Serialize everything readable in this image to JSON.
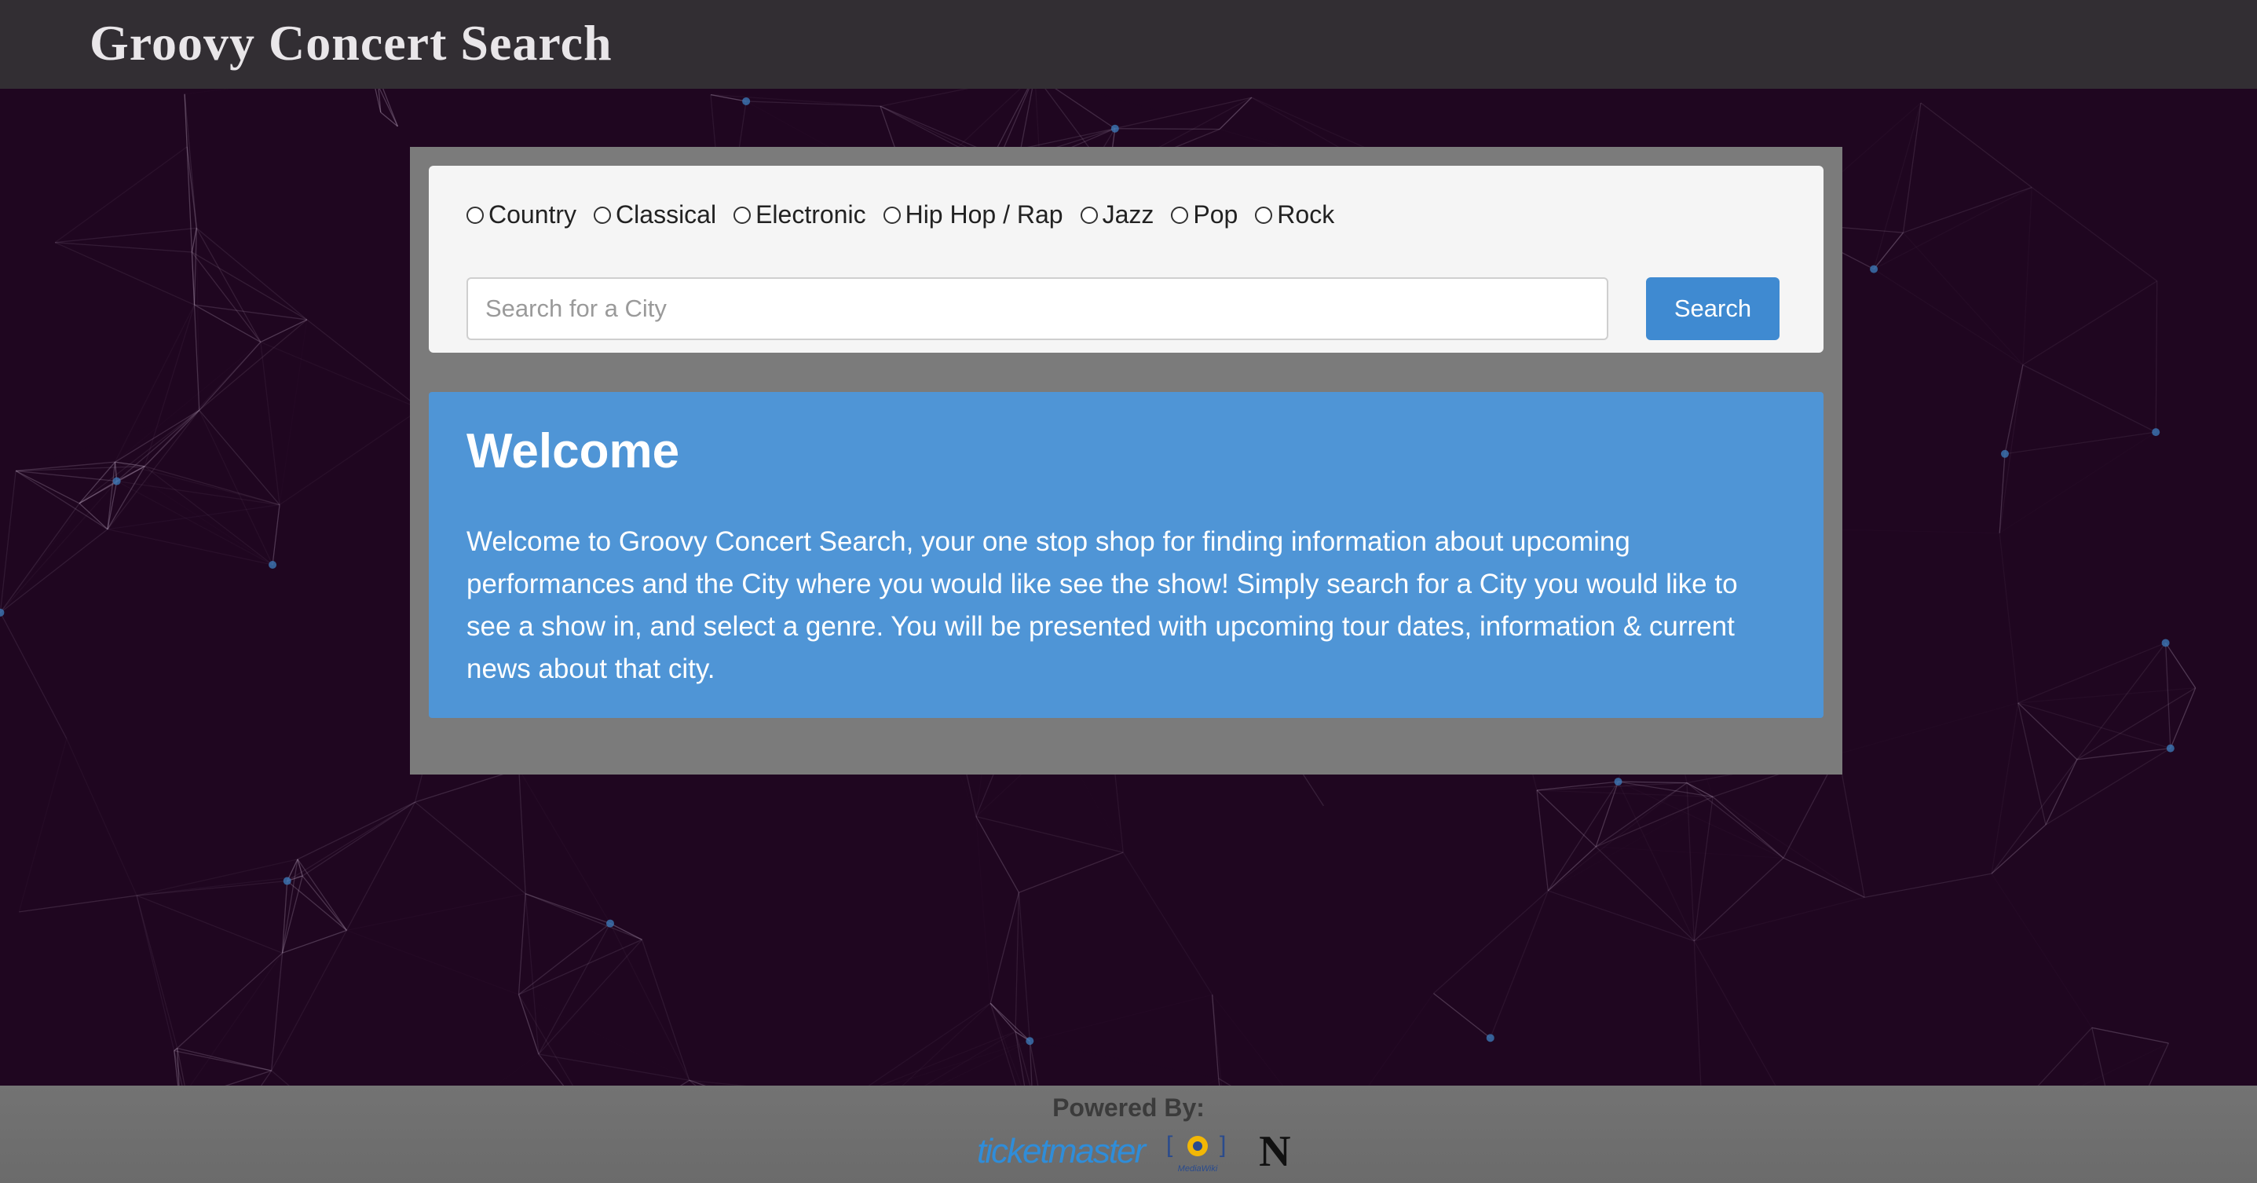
{
  "header": {
    "title": "Groovy Concert Search"
  },
  "search": {
    "genres": [
      {
        "label": "Country",
        "selected": false
      },
      {
        "label": "Classical",
        "selected": false
      },
      {
        "label": "Electronic",
        "selected": false
      },
      {
        "label": "Hip Hop / Rap",
        "selected": false
      },
      {
        "label": "Jazz",
        "selected": false
      },
      {
        "label": "Pop",
        "selected": false
      },
      {
        "label": "Rock",
        "selected": false
      }
    ],
    "placeholder": "Search for a City",
    "value": "",
    "button_label": "Search"
  },
  "welcome": {
    "title": "Welcome",
    "text": "Welcome to Groovy Concert Search, your one stop shop for finding information about upcoming performances and the City where you would like see the show! Simply search for a City you would like to see a show in, and select a genre. You will be presented with upcoming tour dates, information & current news about that city."
  },
  "footer": {
    "powered_by": "Powered By:",
    "logos": [
      {
        "name": "ticketmaster-logo",
        "text": "ticketmaster"
      },
      {
        "name": "mediawiki-logo",
        "text": "MediaWiki"
      },
      {
        "name": "newsapi-logo",
        "text": "N"
      }
    ]
  },
  "colors": {
    "background": "#1f0620",
    "header": "#322e33",
    "panel": "#7b7b7b",
    "accent": "#3f8ad1",
    "welcome_card": "#4f95d6"
  }
}
